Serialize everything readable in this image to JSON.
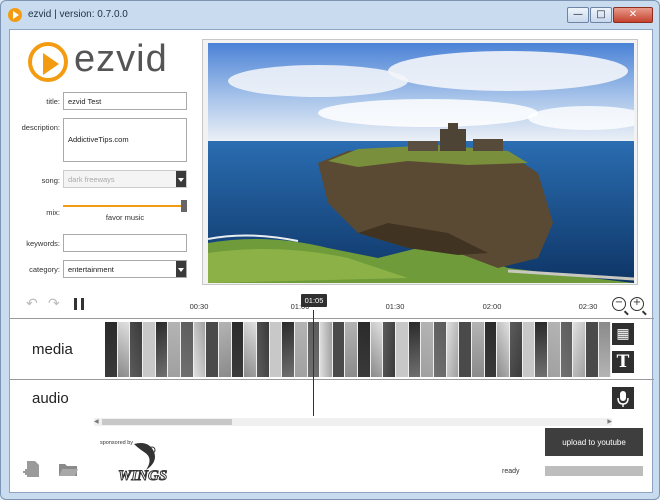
{
  "window": {
    "title": "ezvid | version: 0.7.0.0",
    "minimize": "—",
    "maximize": "□",
    "close": "✕"
  },
  "logo_text": "ezvid",
  "form": {
    "title_label": "title:",
    "title_value": "ezvid Test",
    "description_label": "description:",
    "description_value": "AddictiveTips.com",
    "song_label": "song:",
    "song_value": "dark freeways",
    "mix_label": "mix:",
    "mix_caption": "favor music",
    "mix_level": 1.0,
    "keywords_label": "keywords:",
    "keywords_value": "",
    "category_label": "category:",
    "category_value": "entertainment"
  },
  "timeline": {
    "ticks": [
      "00:30",
      "01:00",
      "01:30",
      "02:00",
      "02:30"
    ],
    "current_time": "01:05",
    "zoom_out": "−",
    "zoom_in": "+"
  },
  "tracks": {
    "media_label": "media",
    "audio_label": "audio",
    "frame_count": 40
  },
  "footer": {
    "sponsored_by": "sponsored by",
    "sponsor_logo_text": "WINGS",
    "upload_label": "upload to youtube",
    "status": "ready",
    "progress": 0.0
  },
  "colors": {
    "accent": "#f39c12",
    "dark_button": "#3e3e3e"
  }
}
